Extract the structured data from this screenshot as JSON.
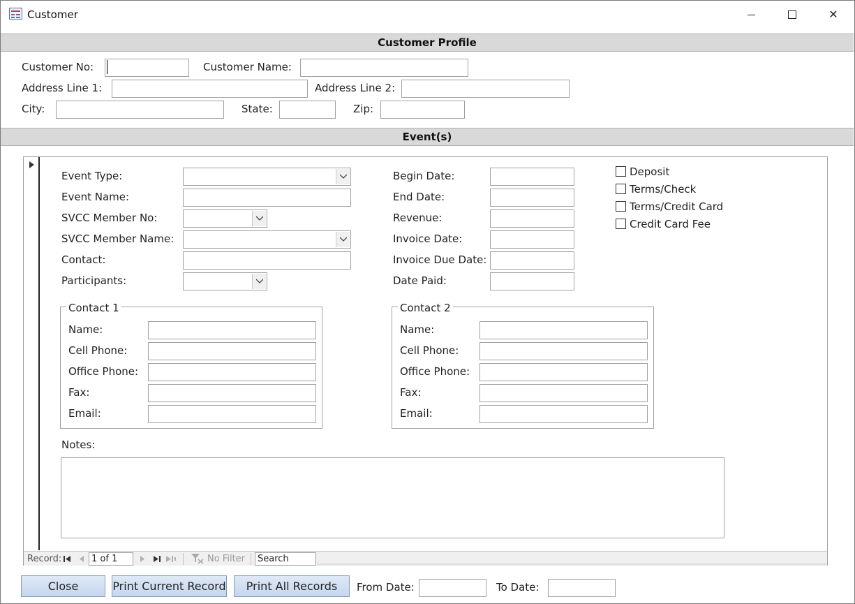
{
  "window": {
    "title": "Customer",
    "icon": "access-form-icon",
    "controls": {
      "minimize": "minimize-icon",
      "maximize": "maximize-icon",
      "close": "close-icon",
      "close_glyph": "✕"
    }
  },
  "customer_profile": {
    "header": "Customer Profile",
    "customer_no_label": "Customer No:",
    "customer_no_value": "",
    "customer_name_label": "Customer Name:",
    "customer_name_value": "",
    "address1_label": "Address Line 1:",
    "address1_value": "",
    "address2_label": "Address Line 2:",
    "address2_value": "",
    "city_label": "City:",
    "city_value": "",
    "state_label": "State:",
    "state_value": "",
    "zip_label": "Zip:",
    "zip_value": ""
  },
  "events": {
    "header": "Event(s)",
    "event_type_label": "Event Type:",
    "event_type_value": "",
    "event_name_label": "Event Name:",
    "event_name_value": "",
    "svcc_member_no_label": "SVCC Member No:",
    "svcc_member_no_value": "",
    "svcc_member_name_label": "SVCC Member Name:",
    "svcc_member_name_value": "",
    "contact_label": "Contact:",
    "contact_value": "",
    "participants_label": "Participants:",
    "participants_value": "",
    "begin_date_label": "Begin Date:",
    "end_date_label": "End Date:",
    "revenue_label": "Revenue:",
    "invoice_date_label": "Invoice Date:",
    "invoice_due_date_label": "Invoice Due Date:",
    "date_paid_label": "Date Paid:",
    "checkboxes": [
      {
        "label": "Deposit",
        "checked": false
      },
      {
        "label": "Terms/Check",
        "checked": false
      },
      {
        "label": "Terms/Credit Card",
        "checked": false
      },
      {
        "label": "Credit Card Fee",
        "checked": false
      }
    ],
    "contact1": {
      "legend": "Contact 1",
      "name_label": "Name:",
      "cell_label": "Cell Phone:",
      "office_label": "Office Phone:",
      "fax_label": "Fax:",
      "email_label": "Email:"
    },
    "contact2": {
      "legend": "Contact 2",
      "name_label": "Name:",
      "cell_label": "Cell Phone:",
      "office_label": "Office Phone:",
      "fax_label": "Fax:",
      "email_label": "Email:"
    },
    "notes_label": "Notes:",
    "notes_value": ""
  },
  "record_nav": {
    "record_label": "Record:",
    "current": "1 of 1",
    "filter_label": "No Filter",
    "search_placeholder": "Search"
  },
  "footer": {
    "close_label": "Close",
    "print_current_label": "Print Current Record",
    "print_all_label": "Print All Records",
    "from_date_label": "From Date:",
    "from_date_value": "",
    "to_date_label": "To Date:",
    "to_date_value": ""
  }
}
